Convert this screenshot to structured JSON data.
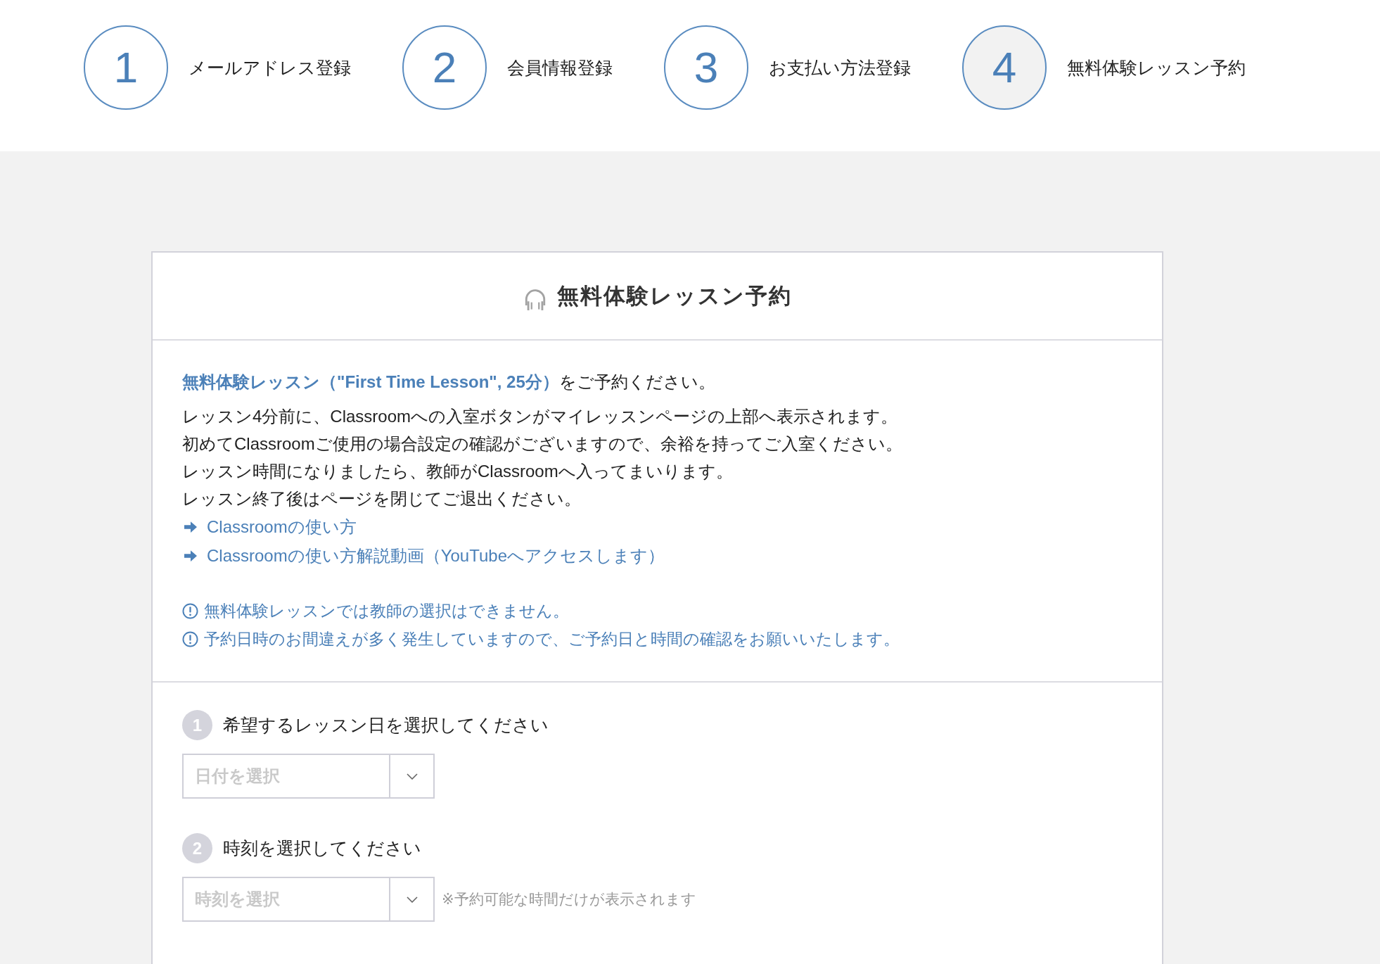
{
  "steps": [
    {
      "number": "1",
      "label": "メールアドレス登録",
      "current": false
    },
    {
      "number": "2",
      "label": "会員情報登録",
      "current": false
    },
    {
      "number": "3",
      "label": "お支払い方法登録",
      "current": false
    },
    {
      "number": "4",
      "label": "無料体験レッスン予約",
      "current": true
    }
  ],
  "card": {
    "title": "無料体験レッスン予約",
    "intro": "**無料体験レッスン（\"First Time Lesson\", 25分）**をご予約ください。",
    "lines": [
      "レッスン4分前に、Classroomへの入室ボタンがマイレッスンページの上部へ表示されます。",
      "初めてClassroomご使用の場合設定の確認がございますので、余裕を持ってご入室ください。",
      "レッスン時間になりましたら、教師がClassroomへ入ってまいります。",
      "レッスン終了後はページを閉じてご退出ください。"
    ],
    "links": [
      "Classroomの使い方",
      "Classroomの使い方解説動画（YouTubeへアクセスします）"
    ],
    "notices": [
      "無料体験レッスンでは教師の選択はできません。",
      "予約日時のお間違えが多く発生していますので、ご予約日と時間の確認をお願いいたします。"
    ]
  },
  "form": {
    "fields": [
      {
        "number": "1",
        "label": "希望するレッスン日を選択してください",
        "placeholder": "日付を選択"
      },
      {
        "number": "2",
        "label": "時刻を選択してください",
        "placeholder": "時刻を選択",
        "note": "※予約可能な時間だけが表示されます"
      }
    ]
  }
}
